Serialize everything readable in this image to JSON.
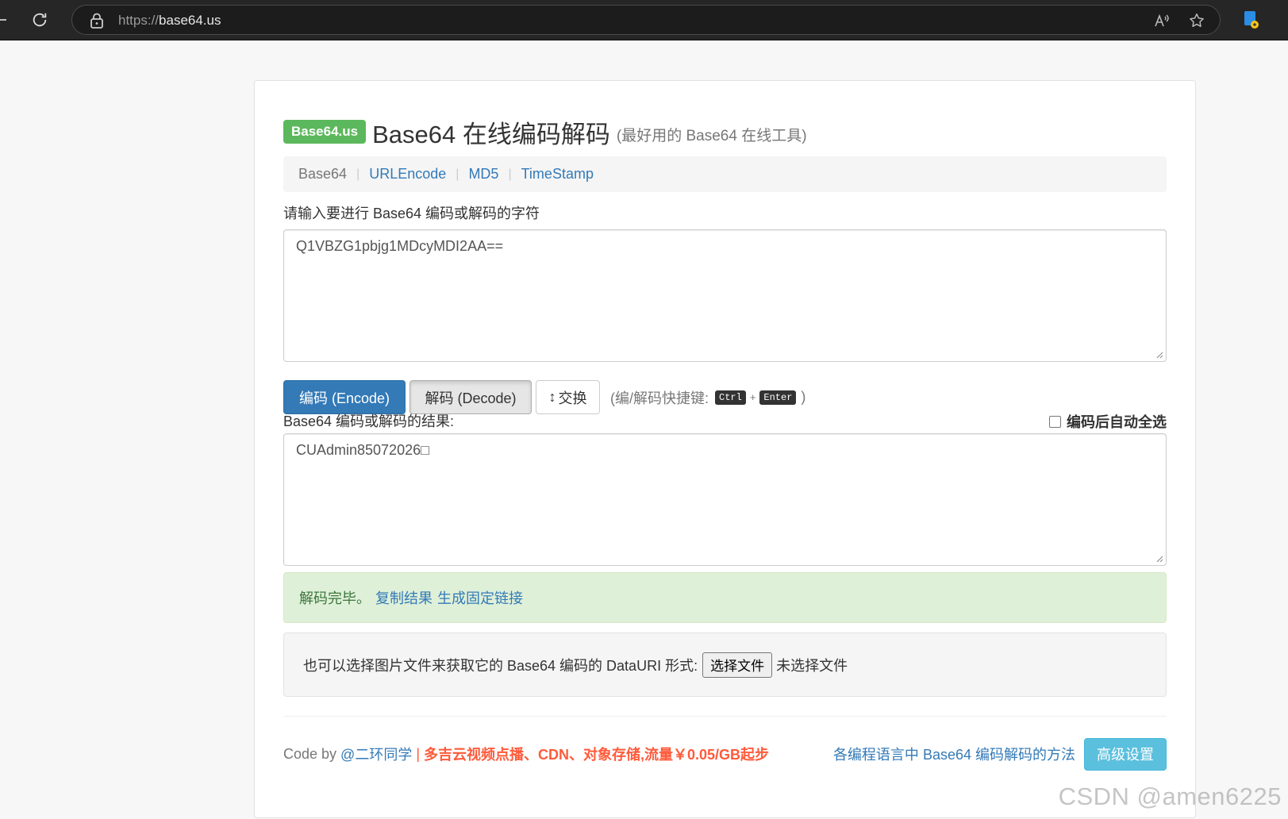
{
  "browser": {
    "url_scheme": "https://",
    "url_host": "base64.us"
  },
  "header": {
    "badge": "Base64.us",
    "title": "Base64 在线编码解码",
    "subtitle": "(最好用的 Base64 在线工具)"
  },
  "nav": {
    "items": [
      "Base64",
      "URLEncode",
      "MD5",
      "TimeStamp"
    ],
    "separator": "|"
  },
  "input": {
    "label": "请输入要进行 Base64 编码或解码的字符",
    "value": "Q1VBZG1pbjg1MDcyMDI2AA=="
  },
  "actions": {
    "encode": "编码 (Encode)",
    "decode": "解码 (Decode)",
    "swap_icon": "↕",
    "swap": "交换",
    "shortcut_prefix": "(编/解码快捷键:",
    "key_ctrl": "Ctrl",
    "key_plus": "+",
    "key_enter": "Enter",
    "shortcut_suffix": ")"
  },
  "result": {
    "label": "Base64 编码或解码的结果:",
    "autoselect_label": "编码后自动全选",
    "value": "CUAdmin85072026□"
  },
  "alert": {
    "status": "解码完毕。",
    "copy_link": "复制结果",
    "permalink": "生成固定链接"
  },
  "file": {
    "label": "也可以选择图片文件来获取它的 Base64 编码的 DataURI 形式:",
    "button": "选择文件",
    "status": "未选择文件"
  },
  "footer": {
    "code_by": "Code by",
    "author": "@二环同学",
    "pipe": "|",
    "promo": "多吉云视频点播、CDN、对象存储,流量￥0.05/GB起步",
    "methods_link": "各编程语言中 Base64 编码解码的方法",
    "advanced": "高级设置"
  },
  "watermark": "CSDN @amen6225",
  "colors": {
    "primary": "#337ab7",
    "success_badge": "#5cb85c",
    "info": "#5bc0de",
    "alert_bg": "#dff0d8",
    "promo": "#ff5a3a"
  }
}
